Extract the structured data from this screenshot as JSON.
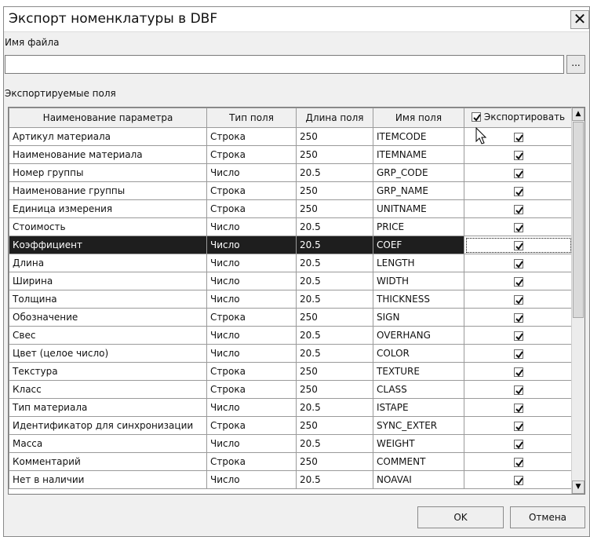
{
  "window": {
    "title": "Экспорт номенклатуры в DBF",
    "close_glyph": "✕"
  },
  "file": {
    "label": "Имя файла",
    "value": "",
    "browse_label": "..."
  },
  "fields": {
    "label": "Экспортируемые поля",
    "columns": [
      "Наименование параметра",
      "Тип поля",
      "Длина поля",
      "Имя поля",
      "Экспортировать"
    ],
    "export_all_checked": true,
    "selected_row_index": 6,
    "rows": [
      {
        "name": "Артикул материала",
        "type": "Строка",
        "length": "250",
        "field": "ITEMCODE",
        "export": true
      },
      {
        "name": "Наименование материала",
        "type": "Строка",
        "length": "250",
        "field": "ITEMNAME",
        "export": true
      },
      {
        "name": "Номер группы",
        "type": "Число",
        "length": "20.5",
        "field": "GRP_CODE",
        "export": true
      },
      {
        "name": "Наименование группы",
        "type": "Строка",
        "length": "250",
        "field": "GRP_NAME",
        "export": true
      },
      {
        "name": "Единица измерения",
        "type": "Строка",
        "length": "250",
        "field": "UNITNAME",
        "export": true
      },
      {
        "name": "Стоимость",
        "type": "Число",
        "length": "20.5",
        "field": "PRICE",
        "export": true
      },
      {
        "name": "Коэффициент",
        "type": "Число",
        "length": "20.5",
        "field": "COEF",
        "export": true
      },
      {
        "name": "Длина",
        "type": "Число",
        "length": "20.5",
        "field": "LENGTH",
        "export": true
      },
      {
        "name": "Ширина",
        "type": "Число",
        "length": "20.5",
        "field": "WIDTH",
        "export": true
      },
      {
        "name": "Толщина",
        "type": "Число",
        "length": "20.5",
        "field": "THICKNESS",
        "export": true
      },
      {
        "name": "Обозначение",
        "type": "Строка",
        "length": "250",
        "field": "SIGN",
        "export": true
      },
      {
        "name": "Свес",
        "type": "Число",
        "length": "20.5",
        "field": "OVERHANG",
        "export": true
      },
      {
        "name": "Цвет (целое число)",
        "type": "Число",
        "length": "20.5",
        "field": "COLOR",
        "export": true
      },
      {
        "name": "Текстура",
        "type": "Строка",
        "length": "250",
        "field": "TEXTURE",
        "export": true
      },
      {
        "name": "Класс",
        "type": "Строка",
        "length": "250",
        "field": "CLASS",
        "export": true
      },
      {
        "name": "Тип материала",
        "type": "Число",
        "length": "20.5",
        "field": "ISTAPE",
        "export": true
      },
      {
        "name": "Идентификатор для синхронизации",
        "type": "Строка",
        "length": "250",
        "field": "SYNC_EXTER",
        "export": true
      },
      {
        "name": "Масса",
        "type": "Число",
        "length": "20.5",
        "field": "WEIGHT",
        "export": true
      },
      {
        "name": "Комментарий",
        "type": "Строка",
        "length": "250",
        "field": "COMMENT",
        "export": true
      },
      {
        "name": "Нет в наличии",
        "type": "Число",
        "length": "20.5",
        "field": "NOAVAI",
        "export": true
      }
    ]
  },
  "buttons": {
    "ok": "OK",
    "cancel": "Отмена"
  },
  "icons": {
    "checkbox": "check-icon",
    "scroll_up": "▲",
    "scroll_down": "▼",
    "cursor": "mouse-pointer-icon"
  },
  "colors": {
    "selected_row_bg": "#1e1e1e",
    "selected_row_fg": "#ffffff",
    "dialog_bg": "#f0f0f0"
  }
}
